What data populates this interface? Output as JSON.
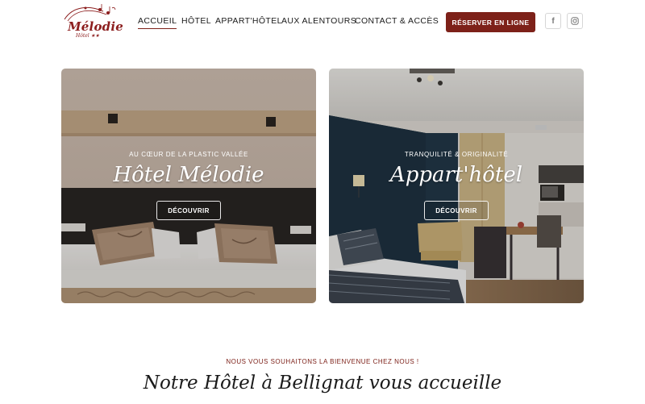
{
  "brand": {
    "name": "Mélodie",
    "subtitle": "Hôtel ★★"
  },
  "nav": {
    "items": [
      "ACCUEIL",
      "HÔTEL",
      "APPART'HÔTEL",
      "AUX ALENTOURS",
      "CONTACT & ACCÈS"
    ],
    "active": "ACCUEIL"
  },
  "cta": {
    "label": "RÉSERVER EN LIGNE",
    "color": "#7d2119"
  },
  "social": [
    {
      "icon": "facebook-icon",
      "glyph": "f"
    },
    {
      "icon": "instagram-icon",
      "glyph": "◎"
    }
  ],
  "cards": [
    {
      "kicker": "AU CŒUR DE LA PLASTIC VALLÉE",
      "title": "Hôtel Mélodie",
      "button": "DÉCOUVRIR"
    },
    {
      "kicker": "TRANQUILITÉ & ORIGINALITÉ",
      "title": "Appart'hôtel",
      "button": "DÉCOUVRIR"
    }
  ],
  "welcome": {
    "kicker": "NOUS VOUS SOUHAITONS LA BIENVENUE CHEZ NOUS !",
    "title": "Notre Hôtel à Bellignat vous accueille"
  }
}
